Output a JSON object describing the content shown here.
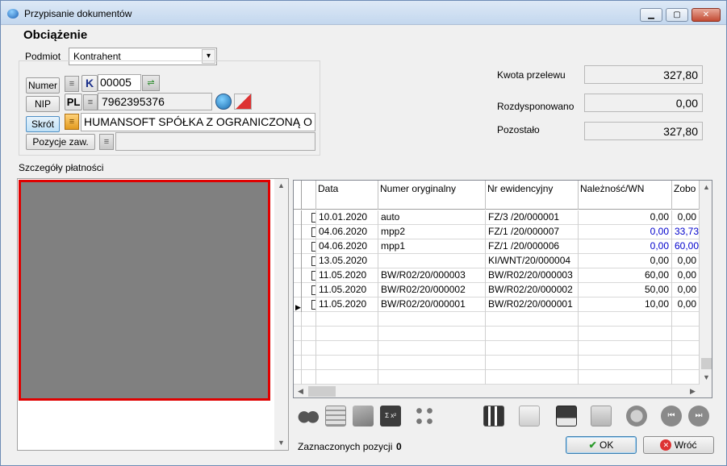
{
  "window": {
    "title": "Przypisanie dokumentów"
  },
  "heading": "Obciążenie",
  "podmiot": {
    "label": "Podmiot",
    "value": "Kontrahent"
  },
  "buttons": {
    "numer": "Numer",
    "nip": "NIP",
    "skrot": "Skrót",
    "pozycje": "Pozycje zaw.",
    "k_badge": "K",
    "pl_badge": "PL"
  },
  "contractor": {
    "number": "00005",
    "nip": "7962395376",
    "name": "HUMANSOFT SPÓŁKA Z OGRANICZONĄ O",
    "pozycje_value": ""
  },
  "amounts": {
    "kwota_label": "Kwota przelewu",
    "kwota_value": "327,80",
    "rozdysp_label": "Rozdysponowano",
    "rozdysp_value": "0,00",
    "pozostalo_label": "Pozostało",
    "pozostalo_value": "327,80"
  },
  "details_label": "Szczegóły płatności",
  "grid": {
    "columns": [
      "Data",
      "Numer oryginalny",
      "Nr ewidencyjny",
      "Należność/WN",
      "Zobo"
    ],
    "rows": [
      {
        "date": "10.01.2020",
        "orig": "auto",
        "ewid": "FZ/3  /20/000001",
        "nal": "0,00",
        "zobo": "0,00",
        "blue": false
      },
      {
        "date": "04.06.2020",
        "orig": "mpp2",
        "ewid": "FZ/1  /20/000007",
        "nal": "0,00",
        "zobo": "33,73",
        "blue": true
      },
      {
        "date": "04.06.2020",
        "orig": "mpp1",
        "ewid": "FZ/1  /20/000006",
        "nal": "0,00",
        "zobo": "60,00",
        "blue": true
      },
      {
        "date": "13.05.2020",
        "orig": "",
        "ewid": "KI/WNT/20/000004",
        "nal": "0,00",
        "zobo": "0,00",
        "blue": false
      },
      {
        "date": "11.05.2020",
        "orig": "BW/R02/20/000003",
        "ewid": "BW/R02/20/000003",
        "nal": "60,00",
        "zobo": "0,00",
        "blue": false
      },
      {
        "date": "11.05.2020",
        "orig": "BW/R02/20/000002",
        "ewid": "BW/R02/20/000002",
        "nal": "50,00",
        "zobo": "0,00",
        "blue": false
      },
      {
        "date": "11.05.2020",
        "orig": "BW/R02/20/000001",
        "ewid": "BW/R02/20/000001",
        "nal": "10,00",
        "zobo": "0,00",
        "blue": false
      }
    ]
  },
  "status": {
    "label": "Zaznaczonych pozycji",
    "value": "0"
  },
  "actions": {
    "ok": "OK",
    "back": "Wróć"
  },
  "colors": {
    "accent_blue": "#0000cc",
    "highlight_red": "#e00000"
  }
}
